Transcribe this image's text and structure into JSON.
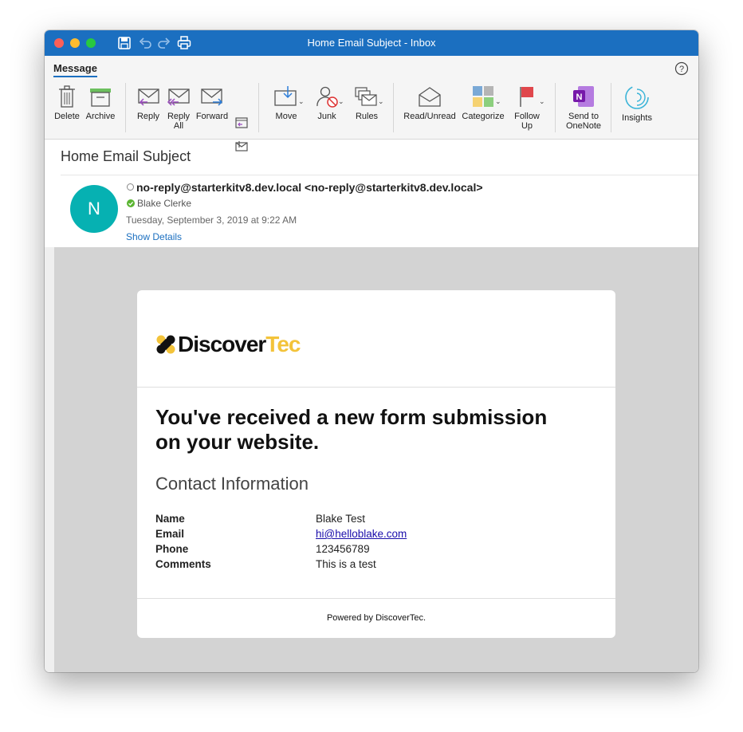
{
  "window": {
    "title": "Home Email Subject - Inbox"
  },
  "ribbon": {
    "tab": "Message",
    "buttons": {
      "delete": "Delete",
      "archive": "Archive",
      "reply": "Reply",
      "reply_all": "Reply All",
      "forward": "Forward",
      "move": "Move",
      "junk": "Junk",
      "rules": "Rules",
      "read_unread": "Read/Unread",
      "categorize": "Categorize",
      "follow_up": "Follow Up",
      "send_to_onenote": "Send to OneNote",
      "insights": "Insights"
    }
  },
  "message": {
    "subject": "Home Email Subject",
    "avatar_initial": "N",
    "sender": "no-reply@starterkitv8.dev.local <no-reply@starterkitv8.dev.local>",
    "recipient": "Blake Clerke",
    "date": "Tuesday, September 3, 2019 at 9:22 AM",
    "show_details": "Show Details"
  },
  "email_body": {
    "logo_part1": "Discover",
    "logo_part2": "Tec",
    "headline": "You've received a new form submission on your website.",
    "section_title": "Contact Information",
    "fields": [
      {
        "label": "Name",
        "value": "Blake Test"
      },
      {
        "label": "Email",
        "value": "hi@helloblake.com"
      },
      {
        "label": "Phone",
        "value": "123456789"
      },
      {
        "label": "Comments",
        "value": "This is a test"
      }
    ],
    "footer": "Powered by DiscoverTec."
  },
  "colors": {
    "titlebar": "#1b6fc0",
    "avatar": "#06b1b2",
    "logo_accent": "#f3c33a",
    "body_background": "#d3d3d3"
  }
}
